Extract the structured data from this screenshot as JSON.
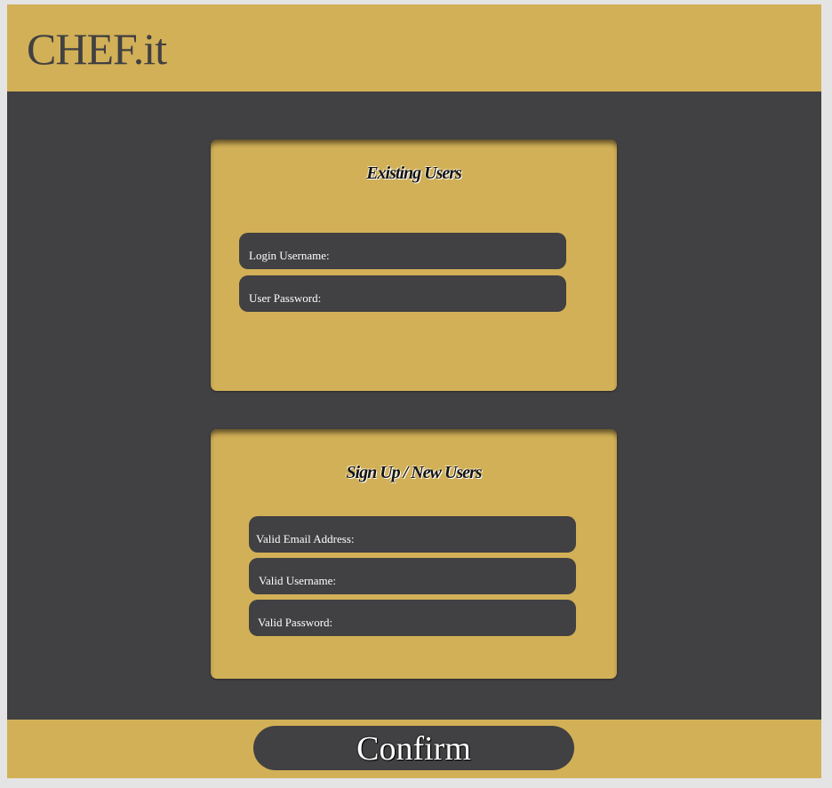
{
  "header": {
    "logo": "CHEF.it"
  },
  "login": {
    "title": "Existing Users",
    "username_placeholder": "Login Username:",
    "password_placeholder": "User Password:"
  },
  "signup": {
    "title": "Sign Up / New Users",
    "email_placeholder": "Valid Email Address:",
    "username_placeholder": "Valid Username:",
    "password_placeholder": "Valid Password:"
  },
  "footer": {
    "confirm_label": "Confirm"
  },
  "colors": {
    "gold": "#d2b057",
    "charcoal": "#414042",
    "page_background": "#e4e4e4"
  }
}
